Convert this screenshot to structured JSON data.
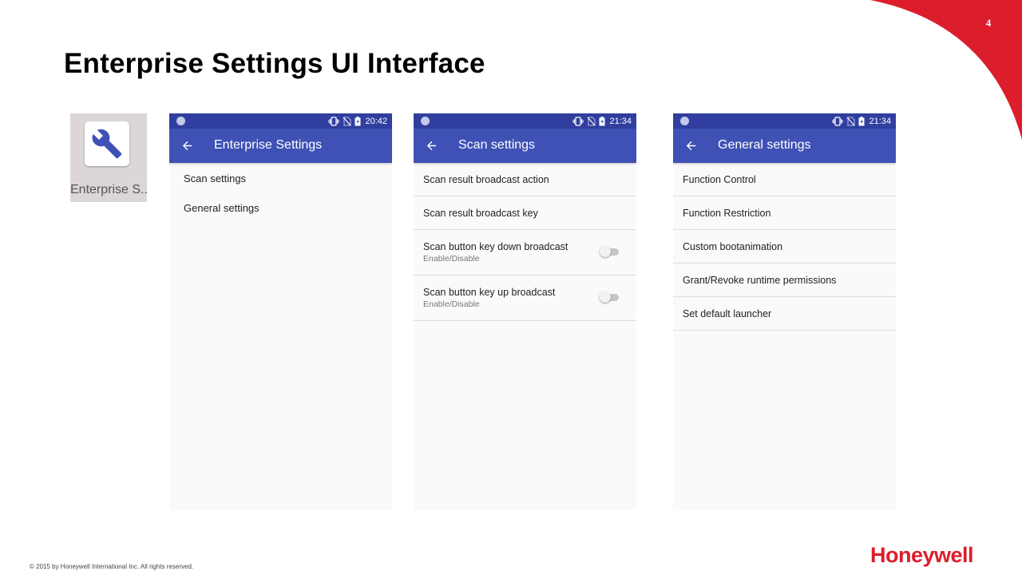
{
  "slide": {
    "page_number": "4",
    "title": "Enterprise Settings UI Interface",
    "copyright": "© 2015 by Honeywell International Inc. All rights reserved.",
    "logo": "Honeywell",
    "accent_color": "#dc1e2c"
  },
  "app_tile": {
    "label": "Enterprise S..",
    "icon": "wrench-icon"
  },
  "phones": [
    {
      "time": "20:42",
      "title": "Enterprise Settings",
      "items": [
        {
          "label": "Scan settings"
        },
        {
          "label": "General settings"
        }
      ]
    },
    {
      "time": "21:34",
      "title": "Scan settings",
      "items": [
        {
          "label": "Scan result broadcast action"
        },
        {
          "label": "Scan result broadcast key"
        },
        {
          "label": "Scan button key down broadcast",
          "sub": "Enable/Disable",
          "toggle": false
        },
        {
          "label": "Scan button key up broadcast",
          "sub": "Enable/Disable",
          "toggle": false
        }
      ]
    },
    {
      "time": "21:34",
      "title": "General settings",
      "items": [
        {
          "label": "Function Control"
        },
        {
          "label": "Function Restriction"
        },
        {
          "label": "Custom bootanimation"
        },
        {
          "label": "Grant/Revoke runtime permissions"
        },
        {
          "label": "Set default launcher"
        }
      ]
    }
  ],
  "colors": {
    "statusbar": "#303f9f",
    "appbar": "#3f51b5"
  }
}
